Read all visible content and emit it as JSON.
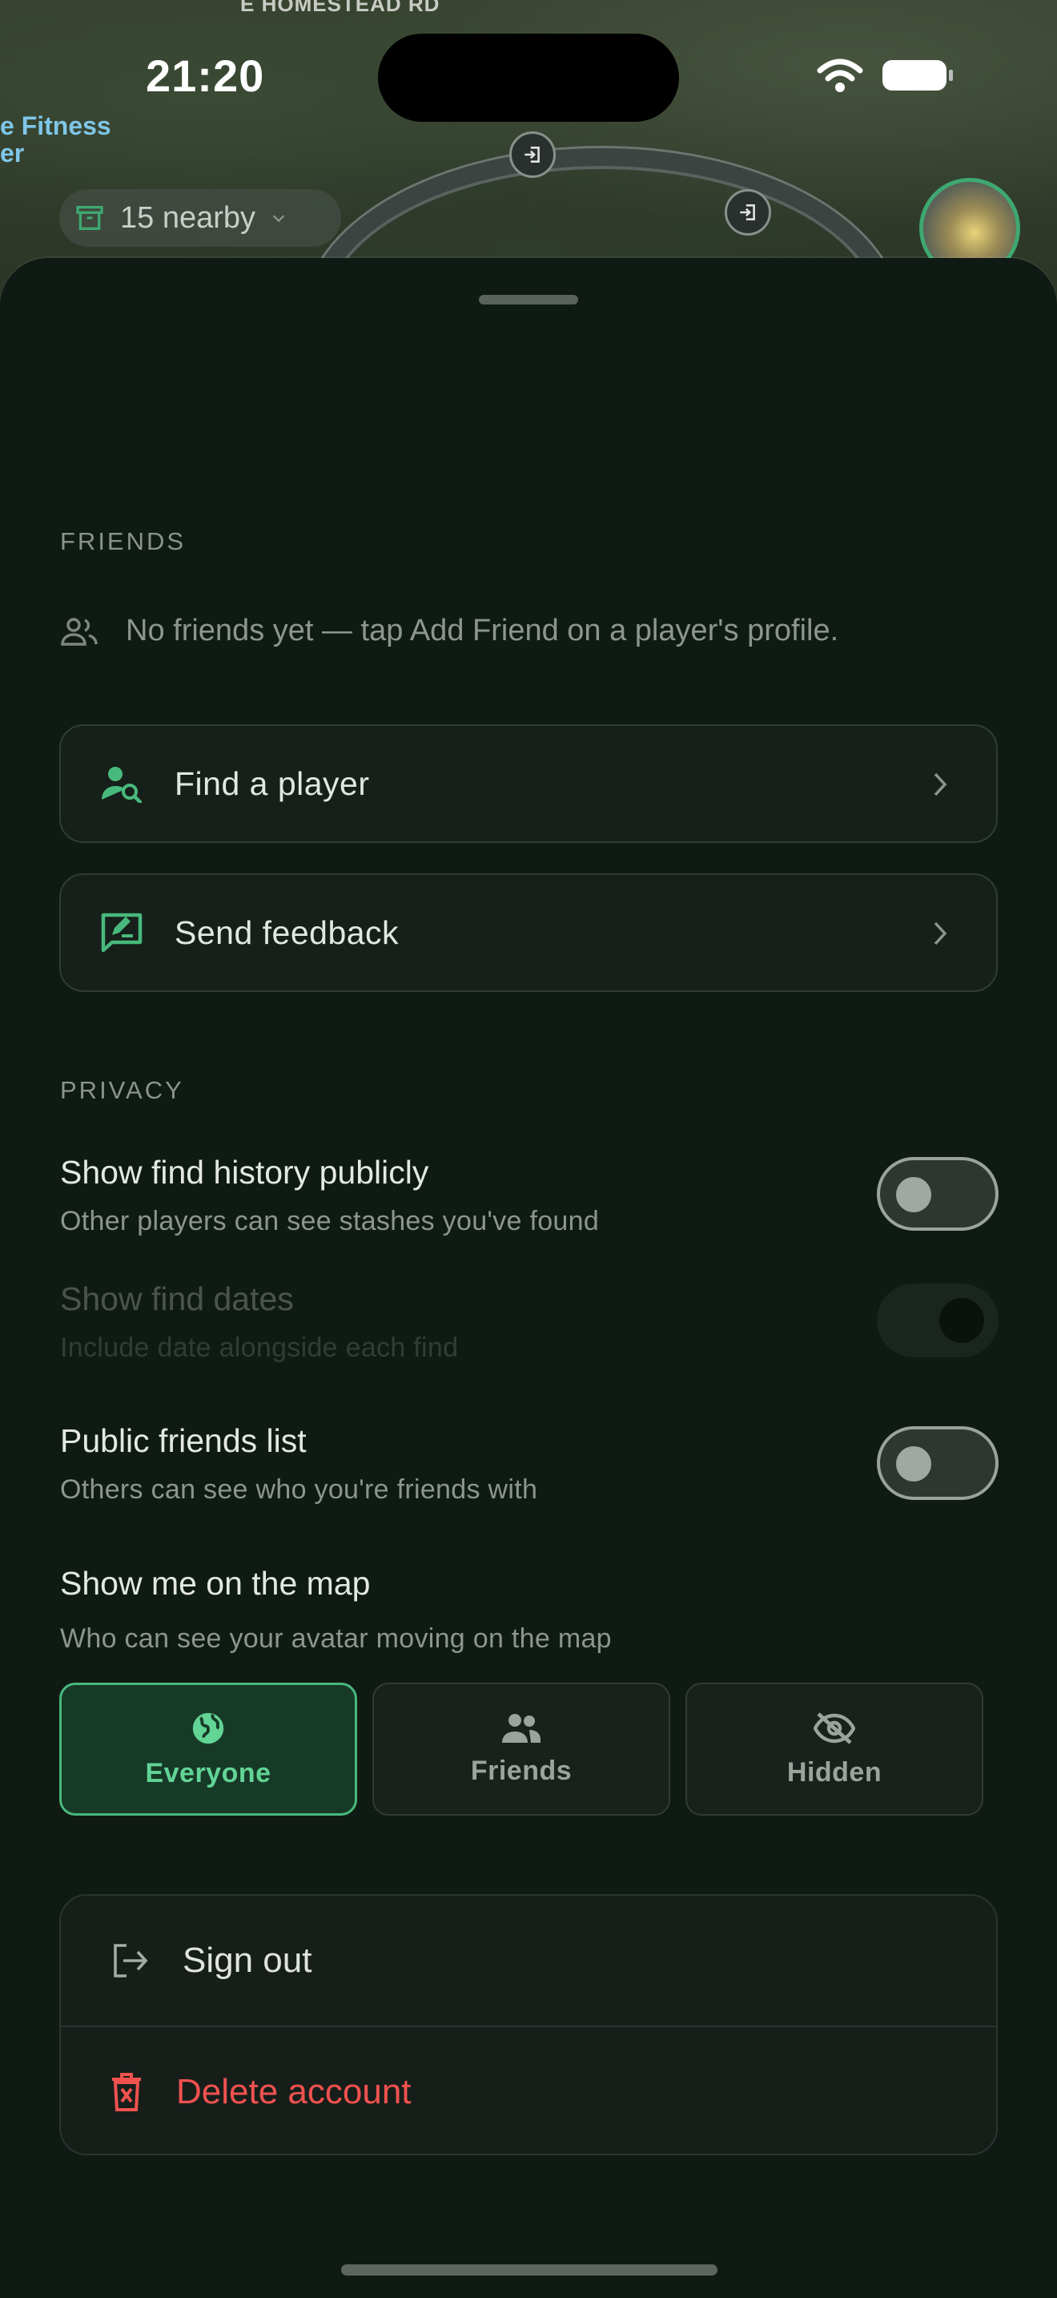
{
  "status_bar": {
    "time": "21:20"
  },
  "map": {
    "road_label": "E HOMESTEAD RD",
    "poi_label_line1": "e Fitness",
    "poi_label_line2": "er",
    "nearby_label": "15 nearby"
  },
  "friends": {
    "heading": "FRIENDS",
    "empty_text": "No friends yet — tap Add Friend on a player's profile."
  },
  "actions": [
    {
      "label": "Find a player",
      "icon": "find-person-icon"
    },
    {
      "label": "Send feedback",
      "icon": "feedback-icon"
    }
  ],
  "privacy": {
    "heading": "PRIVACY",
    "show_find_history": {
      "title": "Show find history publicly",
      "subtitle": "Other players can see stashes you've found",
      "on": false
    },
    "show_find_dates": {
      "title": "Show find dates",
      "subtitle": "Include date alongside each find",
      "on": false,
      "disabled": true
    },
    "public_friends_list": {
      "title": "Public friends list",
      "subtitle": "Others can see who you're friends with",
      "on": false
    },
    "show_on_map": {
      "title": "Show me on the map",
      "subtitle": "Who can see your avatar moving on the map",
      "selected": "Everyone",
      "options": [
        {
          "label": "Everyone",
          "icon": "globe-icon"
        },
        {
          "label": "Friends",
          "icon": "people-icon"
        },
        {
          "label": "Hidden",
          "icon": "eye-off-icon"
        }
      ]
    }
  },
  "account": {
    "sign_out": "Sign out",
    "delete_account": "Delete account"
  },
  "colors": {
    "accent": "#48b97c",
    "danger": "#f0524f",
    "sheet_bg": "#101a14"
  }
}
